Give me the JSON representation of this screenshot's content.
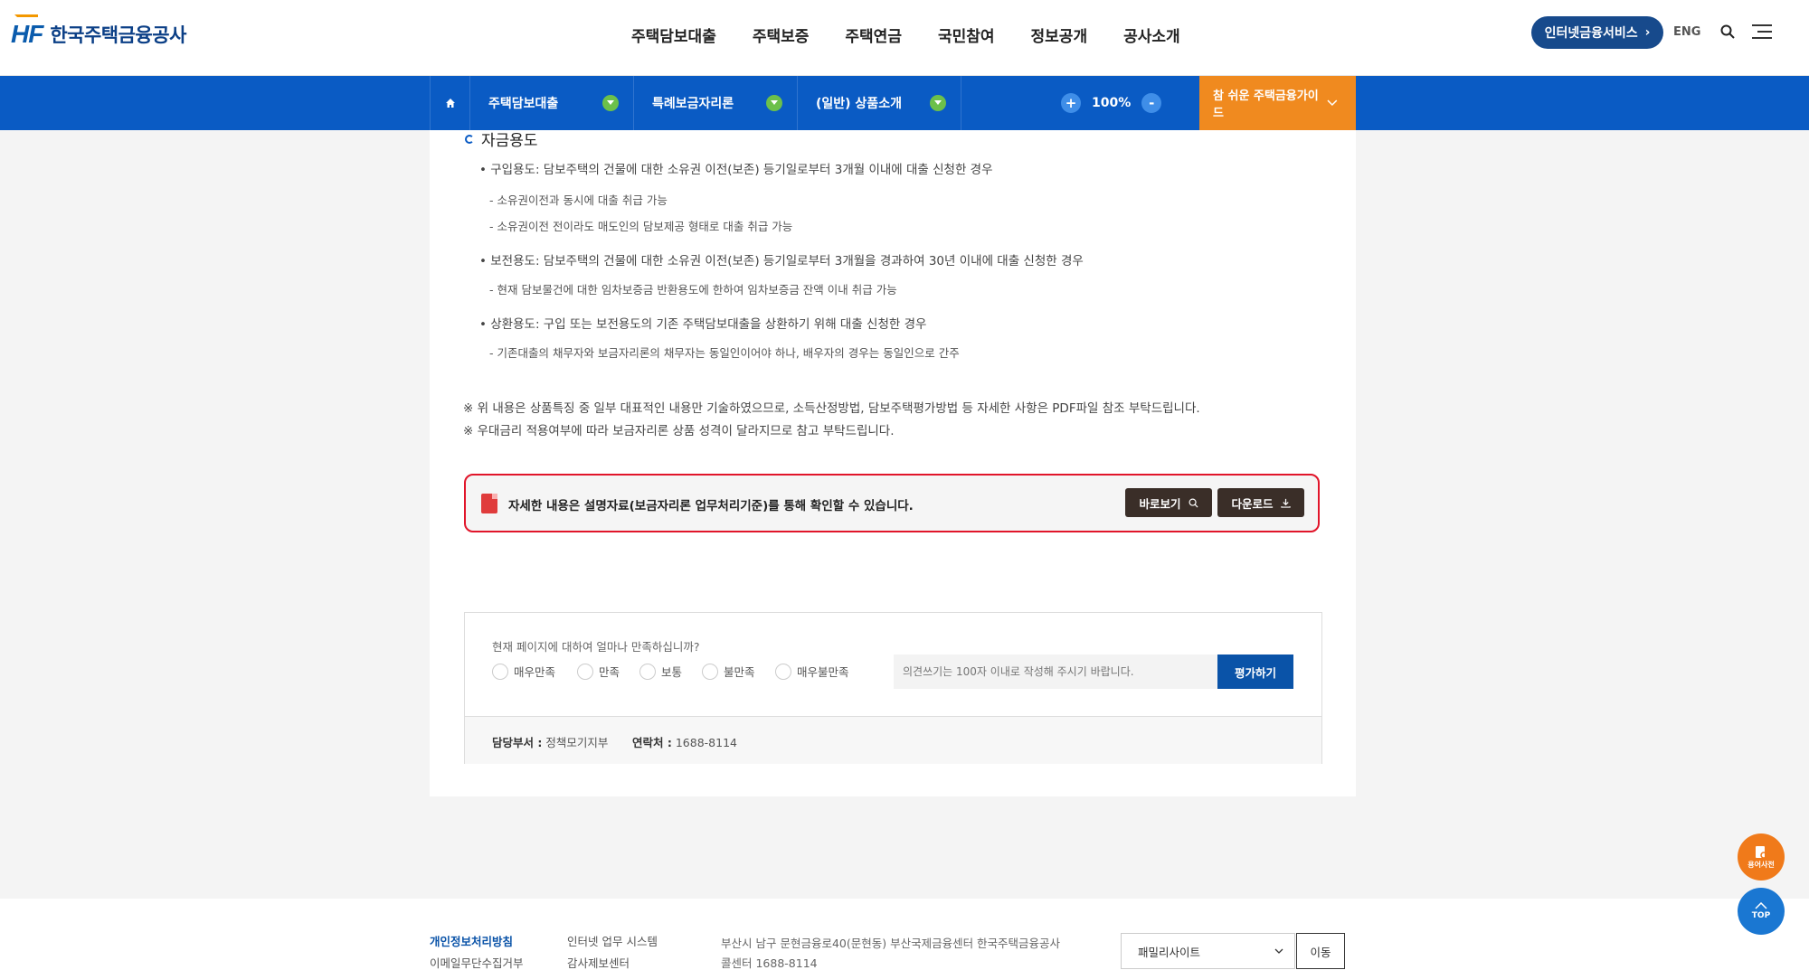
{
  "header": {
    "logo_mark": "HF",
    "logo_text": "한국주택금융공사",
    "nav": [
      "주택담보대출",
      "주택보증",
      "주택연금",
      "국민참여",
      "정보공개",
      "공사소개"
    ],
    "internet_service": "인터넷금융서비스",
    "lang": "ENG"
  },
  "subnav": {
    "crumbs": [
      "주택담보대출",
      "특례보금자리론",
      "(일반) 상품소개"
    ],
    "zoom_plus": "+",
    "zoom_level": "100%",
    "zoom_minus": "-",
    "guide": "참 쉬운 주택금융가이드"
  },
  "content": {
    "section_title": "자금용도",
    "items": [
      "구입용도: 담보주택의 건물에 대한 소유권 이전(보존) 등기일로부터 3개월 이내에 대출 신청한 경우",
      "소유권이전과 동시에 대출 취급 가능",
      "소유권이전 전이라도 매도인의 담보제공 형태로 대출 취급 가능",
      "보전용도: 담보주택의 건물에 대한 소유권 이전(보존) 등기일로부터 3개월을 경과하여 30년 이내에 대출 신청한 경우",
      "현재 담보물건에 대한 임차보증금 반환용도에 한하여 임차보증금 잔액 이내 취급 가능",
      "상환용도: 구입 또는 보전용도의 기존 주택담보대출을 상환하기 위해 대출 신청한 경우",
      "기존대출의 채무자와 보금자리론의 채무자는 동일인이어야 하나, 배우자의 경우는 동일인으로 간주"
    ],
    "notes": [
      "※ 위 내용은 상품특징 중 일부 대표적인 내용만 기술하였으므로, 소득산정방법, 담보주택평가방법 등 자세한 사항은 PDF파일 참조 부탁드립니다.",
      "※ 우대금리 적용여부에 따라 보금자리론 상품 성격이 달라지므로 참고 부탁드립니다."
    ],
    "doc_text": "자세한 내용은 설명자료(보금자리론 업무처리기준)를 통해 확인할 수 있습니다.",
    "view_btn": "바로보기",
    "download_btn": "다운로드"
  },
  "survey": {
    "question": "현재 페이지에 대하여 얼마나 만족하십니까?",
    "options": [
      "매우만족",
      "만족",
      "보통",
      "불만족",
      "매우불만족"
    ],
    "placeholder": "의견쓰기는 100자 이내로 작성해 주시기 바랍니다.",
    "submit": "평가하기",
    "dept_label": "담당부서 :",
    "dept": "정책모기지부",
    "contact_label": "연락처 :",
    "contact": "1688-8114"
  },
  "footer": {
    "links_col1": [
      "개인정보처리방침",
      "이메일무단수집거부"
    ],
    "links_col2": [
      "인터넷 업무 시스템",
      "감사제보센터"
    ],
    "address": "부산시 남구 문현금융로40(문현동) 부산국제금융센터 한국주택금융공사",
    "callcenter": "콜센터 1688-8114",
    "family_site": "패밀리사이트",
    "go": "이동"
  },
  "fab": {
    "dictionary": "용어사전",
    "top": "TOP"
  },
  "colors": {
    "primary": "#0a5bc4",
    "accent": "#f08a1f",
    "highlight_border": "#e1152a",
    "doc_button": "#3a2e28"
  }
}
